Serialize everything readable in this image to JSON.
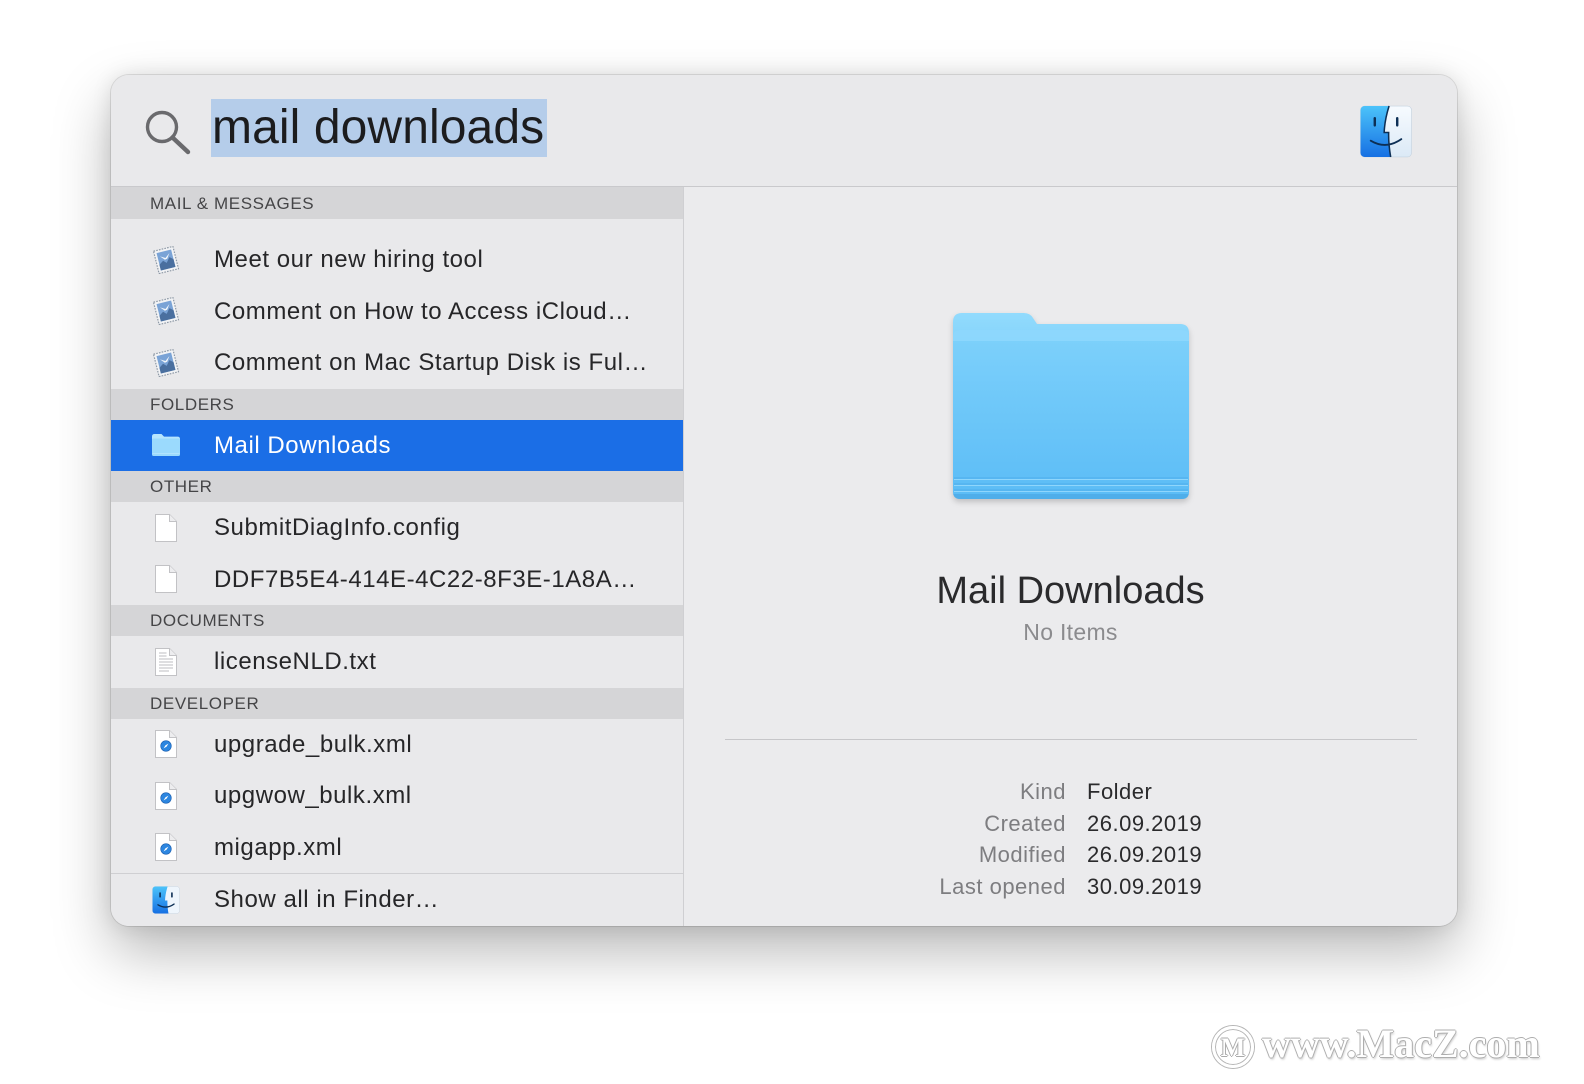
{
  "search": {
    "query": "mail downloads",
    "icon": "magnifying-glass-icon"
  },
  "header_app_icon": "finder-icon",
  "results": {
    "sections": [
      {
        "title": "MAIL & MESSAGES",
        "items": [
          {
            "label": "Meet our new hiring tool",
            "icon": "mail-message-icon"
          },
          {
            "label": "Comment on How to Access iCloud…",
            "icon": "mail-message-icon"
          },
          {
            "label": "Comment on Mac Startup Disk is Ful…",
            "icon": "mail-message-icon"
          }
        ]
      },
      {
        "title": "FOLDERS",
        "items": [
          {
            "label": "Mail Downloads",
            "icon": "folder-icon",
            "selected": true
          }
        ]
      },
      {
        "title": "OTHER",
        "items": [
          {
            "label": "SubmitDiagInfo.config",
            "icon": "blank-document-icon"
          },
          {
            "label": "DDF7B5E4-414E-4C22-8F3E-1A8A…",
            "icon": "blank-document-icon"
          }
        ]
      },
      {
        "title": "DOCUMENTS",
        "items": [
          {
            "label": "licenseNLD.txt",
            "icon": "text-document-icon"
          }
        ]
      },
      {
        "title": "DEVELOPER",
        "items": [
          {
            "label": "upgrade_bulk.xml",
            "icon": "xml-document-icon"
          },
          {
            "label": "upgwow_bulk.xml",
            "icon": "xml-document-icon"
          },
          {
            "label": "migapp.xml",
            "icon": "xml-document-icon"
          }
        ]
      }
    ],
    "show_all": {
      "label": "Show all in Finder…",
      "icon": "finder-icon"
    }
  },
  "preview": {
    "icon": "folder-icon",
    "title": "Mail Downloads",
    "subtitle": "No Items",
    "metadata": [
      {
        "label": "Kind",
        "value": "Folder"
      },
      {
        "label": "Created",
        "value": "26.09.2019"
      },
      {
        "label": "Modified",
        "value": "26.09.2019"
      },
      {
        "label": "Last opened",
        "value": "30.09.2019"
      }
    ]
  },
  "colors": {
    "selection": "#1b6ee6",
    "search_highlight": "#b5cdea",
    "section_header_bg": "#d5d5d7",
    "panel_bg": "#e9e9eb",
    "folder_blue": "#6cc6f9"
  },
  "watermark": {
    "logo_letter": "M",
    "text": "www.MacZ.com"
  }
}
